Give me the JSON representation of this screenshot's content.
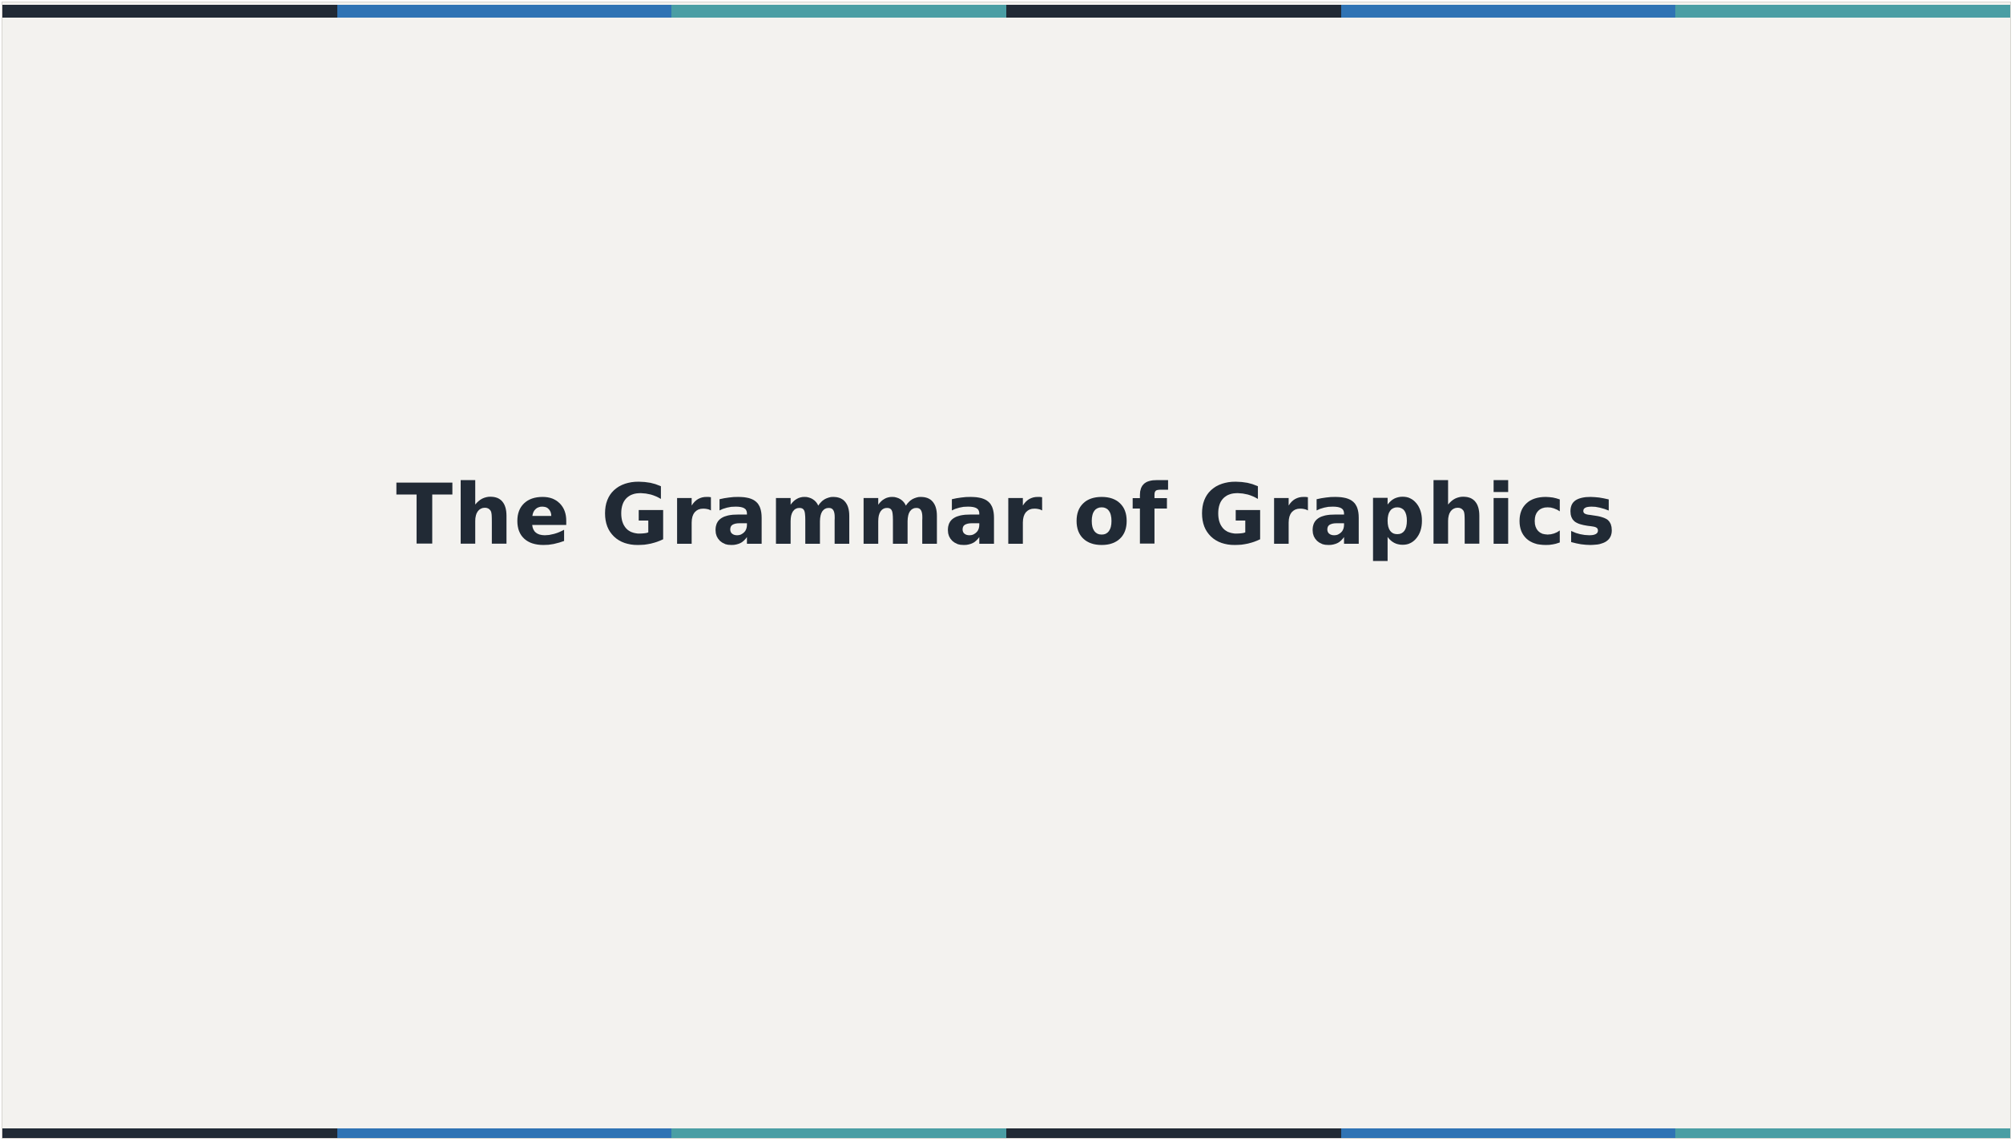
{
  "slide": {
    "title": "The Grammar of Graphics",
    "background_color": "#f3f2ef",
    "title_color": "#212a35"
  },
  "stripes": {
    "colors": [
      "#212a35",
      "#2f73b4",
      "#4a9ea4",
      "#212a35",
      "#2f73b4",
      "#4a9ea4"
    ]
  }
}
